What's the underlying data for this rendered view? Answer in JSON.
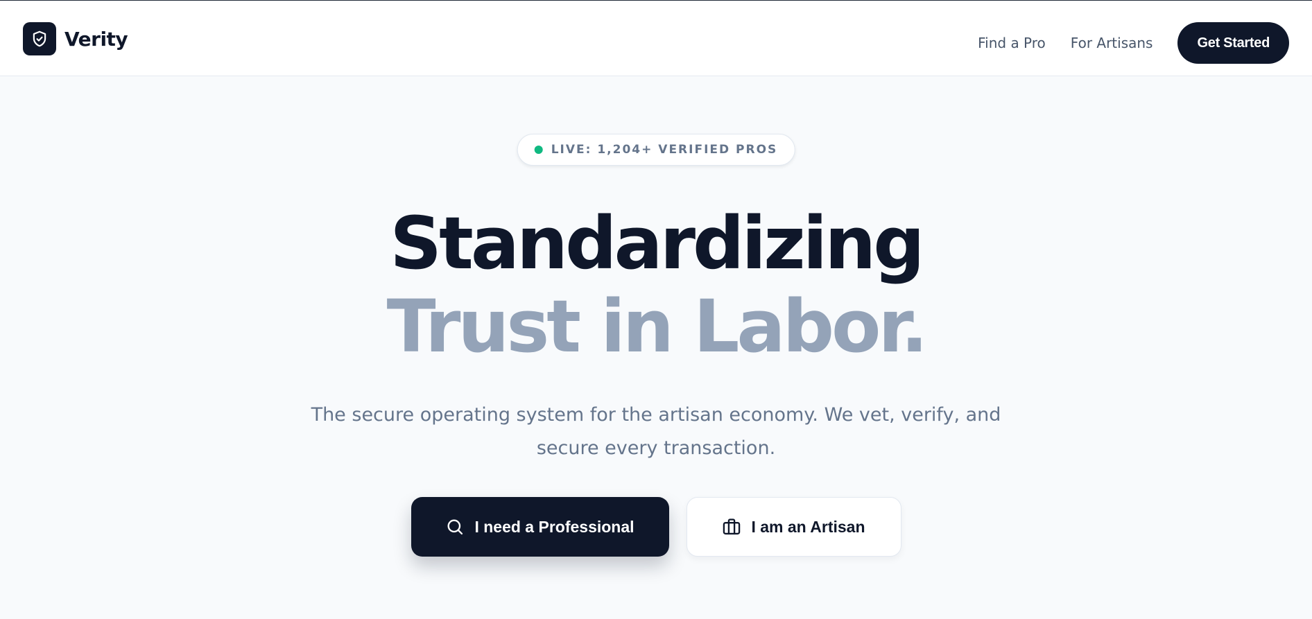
{
  "header": {
    "brand_name": "Verity",
    "nav": {
      "find_pro": "Find a Pro",
      "for_artisans": "For Artisans",
      "cta": "Get Started"
    }
  },
  "hero": {
    "badge_text": "LIVE: 1,204+ VERIFIED PROS",
    "headline_line1": "Standardizing",
    "headline_line2": "Trust in Labor.",
    "subtitle": "The secure operating system for the artisan economy. We vet, verify, and secure every transaction.",
    "primary_button": "I need a Professional",
    "secondary_button": "I am an Artisan"
  },
  "icons": {
    "logo": "shield-check-icon",
    "primary_button": "search-icon",
    "secondary_button": "briefcase-icon"
  },
  "colors": {
    "brand_dark": "#0f172a",
    "headline_muted": "#94a3b8",
    "live_dot": "#10b981",
    "text_muted": "#64748b",
    "background": "#f8fafc"
  }
}
